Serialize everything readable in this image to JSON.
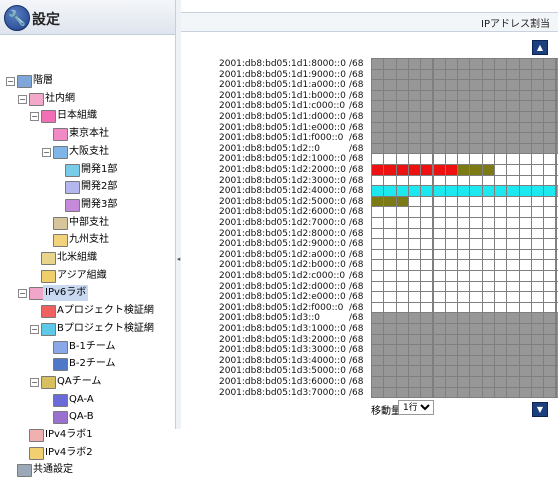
{
  "sidebar": {
    "title": "設定",
    "tree": [
      {
        "label": "階層",
        "depth": 0,
        "toggle": "⊟",
        "icon": "hierarchy-icon",
        "color": "#7ea6d8"
      },
      {
        "label": "社内網",
        "depth": 1,
        "toggle": "⊟",
        "icon": "network-icon",
        "color": "#f2a9c9"
      },
      {
        "label": "日本組織",
        "depth": 2,
        "toggle": "⊟",
        "icon": "network-icon",
        "color": "#f06fb5"
      },
      {
        "label": "東京本社",
        "depth": 3,
        "toggle": "",
        "icon": "network-icon",
        "color": "#f28ac6"
      },
      {
        "label": "大阪支社",
        "depth": 3,
        "toggle": "⊟",
        "icon": "network-icon",
        "color": "#7fb6e8"
      },
      {
        "label": "開発1部",
        "depth": 4,
        "toggle": "",
        "icon": "network-icon",
        "color": "#78cce7"
      },
      {
        "label": "開発2部",
        "depth": 4,
        "toggle": "",
        "icon": "network-icon",
        "color": "#b3b7ee"
      },
      {
        "label": "開発3部",
        "depth": 4,
        "toggle": "",
        "icon": "network-icon",
        "color": "#c58ad9"
      },
      {
        "label": "中部支社",
        "depth": 3,
        "toggle": "",
        "icon": "network-icon",
        "color": "#d8c59c"
      },
      {
        "label": "九州支社",
        "depth": 3,
        "toggle": "",
        "icon": "network-icon",
        "color": "#f2d27a"
      },
      {
        "label": "北米組織",
        "depth": 2,
        "toggle": "",
        "icon": "network-icon",
        "color": "#e8d48a"
      },
      {
        "label": "アジア組織",
        "depth": 2,
        "toggle": "",
        "icon": "network-icon",
        "color": "#f0cf6a"
      },
      {
        "label": "IPv6ラボ",
        "depth": 1,
        "toggle": "⊟",
        "icon": "network-icon",
        "color": "#f0a6c8",
        "selected": true
      },
      {
        "label": "Aプロジェクト検証網",
        "depth": 2,
        "toggle": "",
        "icon": "network-icon",
        "color": "#f06060"
      },
      {
        "label": "Bプロジェクト検証網",
        "depth": 2,
        "toggle": "⊟",
        "icon": "network-icon",
        "color": "#5ec8e8"
      },
      {
        "label": "B-1チーム",
        "depth": 3,
        "toggle": "",
        "icon": "network-icon",
        "color": "#8aa8e8"
      },
      {
        "label": "B-2チーム",
        "depth": 3,
        "toggle": "",
        "icon": "network-icon",
        "color": "#5078c8"
      },
      {
        "label": "QAチーム",
        "depth": 2,
        "toggle": "⊟",
        "icon": "group-icon",
        "color": "#d8c060"
      },
      {
        "label": "QA-A",
        "depth": 3,
        "toggle": "",
        "icon": "network-icon",
        "color": "#6a6ad8"
      },
      {
        "label": "QA-B",
        "depth": 3,
        "toggle": "",
        "icon": "network-icon",
        "color": "#9a70d0"
      },
      {
        "label": "IPv4ラボ1",
        "depth": 1,
        "toggle": "",
        "icon": "network-icon",
        "color": "#f0b0b0"
      },
      {
        "label": "IPv4ラボ2",
        "depth": 1,
        "toggle": "",
        "icon": "network-icon",
        "color": "#f0d070"
      },
      {
        "label": "共通設定",
        "depth": 0,
        "toggle": "",
        "icon": "users-icon",
        "color": "#9aa8b8"
      }
    ]
  },
  "panel": {
    "title": "IPアドレス割当",
    "prefix_len": "/68",
    "addresses": [
      "2001:db8:bd05:1d1:8000::0",
      "2001:db8:bd05:1d1:9000::0",
      "2001:db8:bd05:1d1:a000::0",
      "2001:db8:bd05:1d1:b000::0",
      "2001:db8:bd05:1d1:c000::0",
      "2001:db8:bd05:1d1:d000::0",
      "2001:db8:bd05:1d1:e000::0",
      "2001:db8:bd05:1d1:f000::0",
      "2001:db8:bd05:1d2::0",
      "2001:db8:bd05:1d2:1000::0",
      "2001:db8:bd05:1d2:2000::0",
      "2001:db8:bd05:1d2:3000::0",
      "2001:db8:bd05:1d2:4000::0",
      "2001:db8:bd05:1d2:5000::0",
      "2001:db8:bd05:1d2:6000::0",
      "2001:db8:bd05:1d2:7000::0",
      "2001:db8:bd05:1d2:8000::0",
      "2001:db8:bd05:1d2:9000::0",
      "2001:db8:bd05:1d2:a000::0",
      "2001:db8:bd05:1d2:b000::0",
      "2001:db8:bd05:1d2:c000::0",
      "2001:db8:bd05:1d2:d000::0",
      "2001:db8:bd05:1d2:e000::0",
      "2001:db8:bd05:1d2:f000::0",
      "2001:db8:bd05:1d3::0",
      "2001:db8:bd05:1d3:1000::0",
      "2001:db8:bd05:1d3:2000::0",
      "2001:db8:bd05:1d3:3000::0",
      "2001:db8:bd05:1d3:4000::0",
      "2001:db8:bd05:1d3:5000::0",
      "2001:db8:bd05:1d3:6000::0",
      "2001:db8:bd05:1d3:7000::0"
    ],
    "row_states": [
      "gray",
      "gray",
      "gray",
      "gray",
      "gray",
      "gray",
      "gray",
      "gray",
      "gray",
      "white",
      [
        [
          "red",
          7
        ],
        [
          "olive",
          3
        ],
        [
          "white",
          6
        ]
      ],
      "white",
      "cyan",
      [
        [
          "olive",
          3
        ],
        [
          "white",
          13
        ]
      ],
      "white",
      "white",
      "white",
      "white",
      "white",
      "white",
      "white",
      "white",
      "white",
      "white",
      "gray",
      "gray",
      "gray",
      "gray",
      "gray",
      "gray",
      "gray",
      "gray"
    ],
    "colors": {
      "gray": "#979797",
      "white": "#ffffff",
      "red": "#ee1111",
      "olive": "#7c7a14",
      "cyan": "#1de7ef"
    },
    "scroll_up_icon": "triangle-up-icon",
    "scroll_down_icon": "triangle-down-icon",
    "move_label": "移動量",
    "move_value": "1行"
  }
}
